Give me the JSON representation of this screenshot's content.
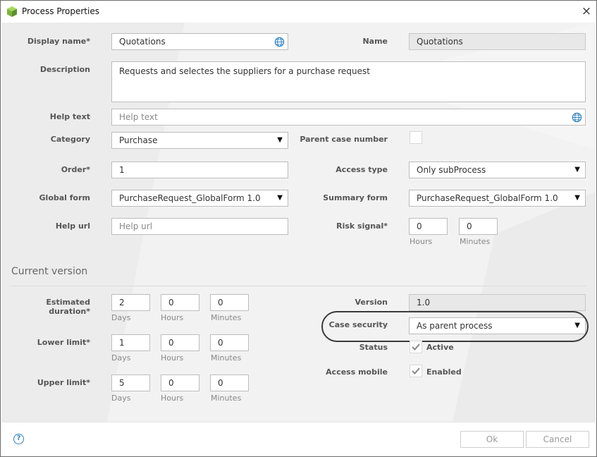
{
  "window": {
    "title": "Process Properties"
  },
  "fields": {
    "display_name": {
      "label": "Display name*",
      "value": "Quotations"
    },
    "name": {
      "label": "Name",
      "value": "Quotations"
    },
    "description": {
      "label": "Description",
      "value": "Requests and selectes the suppliers for a purchase request"
    },
    "help_text": {
      "label": "Help text",
      "placeholder": "Help text"
    },
    "category": {
      "label": "Category",
      "value": "Purchase"
    },
    "parent_case_number": {
      "label": "Parent case number"
    },
    "order": {
      "label": "Order*",
      "value": "1"
    },
    "access_type": {
      "label": "Access type",
      "value": "Only subProcess"
    },
    "global_form": {
      "label": "Global form",
      "value": "PurchaseRequest_GlobalForm 1.0"
    },
    "summary_form": {
      "label": "Summary form",
      "value": "PurchaseRequest_GlobalForm 1.0"
    },
    "help_url": {
      "label": "Help url",
      "placeholder": "Help url"
    },
    "risk_signal": {
      "label": "Risk signal*",
      "hours": "0",
      "minutes": "0",
      "hours_label": "Hours",
      "minutes_label": "Minutes"
    }
  },
  "current_version": {
    "title": "Current version",
    "estimated_duration": {
      "label": "Estimated duration*",
      "days": "2",
      "hours": "0",
      "minutes": "0"
    },
    "lower_limit": {
      "label": "Lower limit*",
      "days": "1",
      "hours": "0",
      "minutes": "0"
    },
    "upper_limit": {
      "label": "Upper limit*",
      "days": "5",
      "hours": "0",
      "minutes": "0"
    },
    "units": {
      "days": "Days",
      "hours": "Hours",
      "minutes": "Minutes"
    },
    "version": {
      "label": "Version",
      "value": "1.0"
    },
    "case_security": {
      "label": "Case security",
      "value": "As parent process"
    },
    "status": {
      "label": "Status",
      "checkbox_label": "Active",
      "checked": true
    },
    "access_mobile": {
      "label": "Access mobile",
      "checkbox_label": "Enabled",
      "checked": true
    }
  },
  "footer": {
    "ok_label": "Ok",
    "cancel_label": "Cancel",
    "help_glyph": "?"
  },
  "icons": {
    "close": "×",
    "select_arrow": "▼",
    "globe": "globe-icon",
    "app": "cube-icon"
  },
  "colors": {
    "accent": "#2c7fbf",
    "highlight_border": "#3a3a3a",
    "cube": "#8dc63f"
  }
}
